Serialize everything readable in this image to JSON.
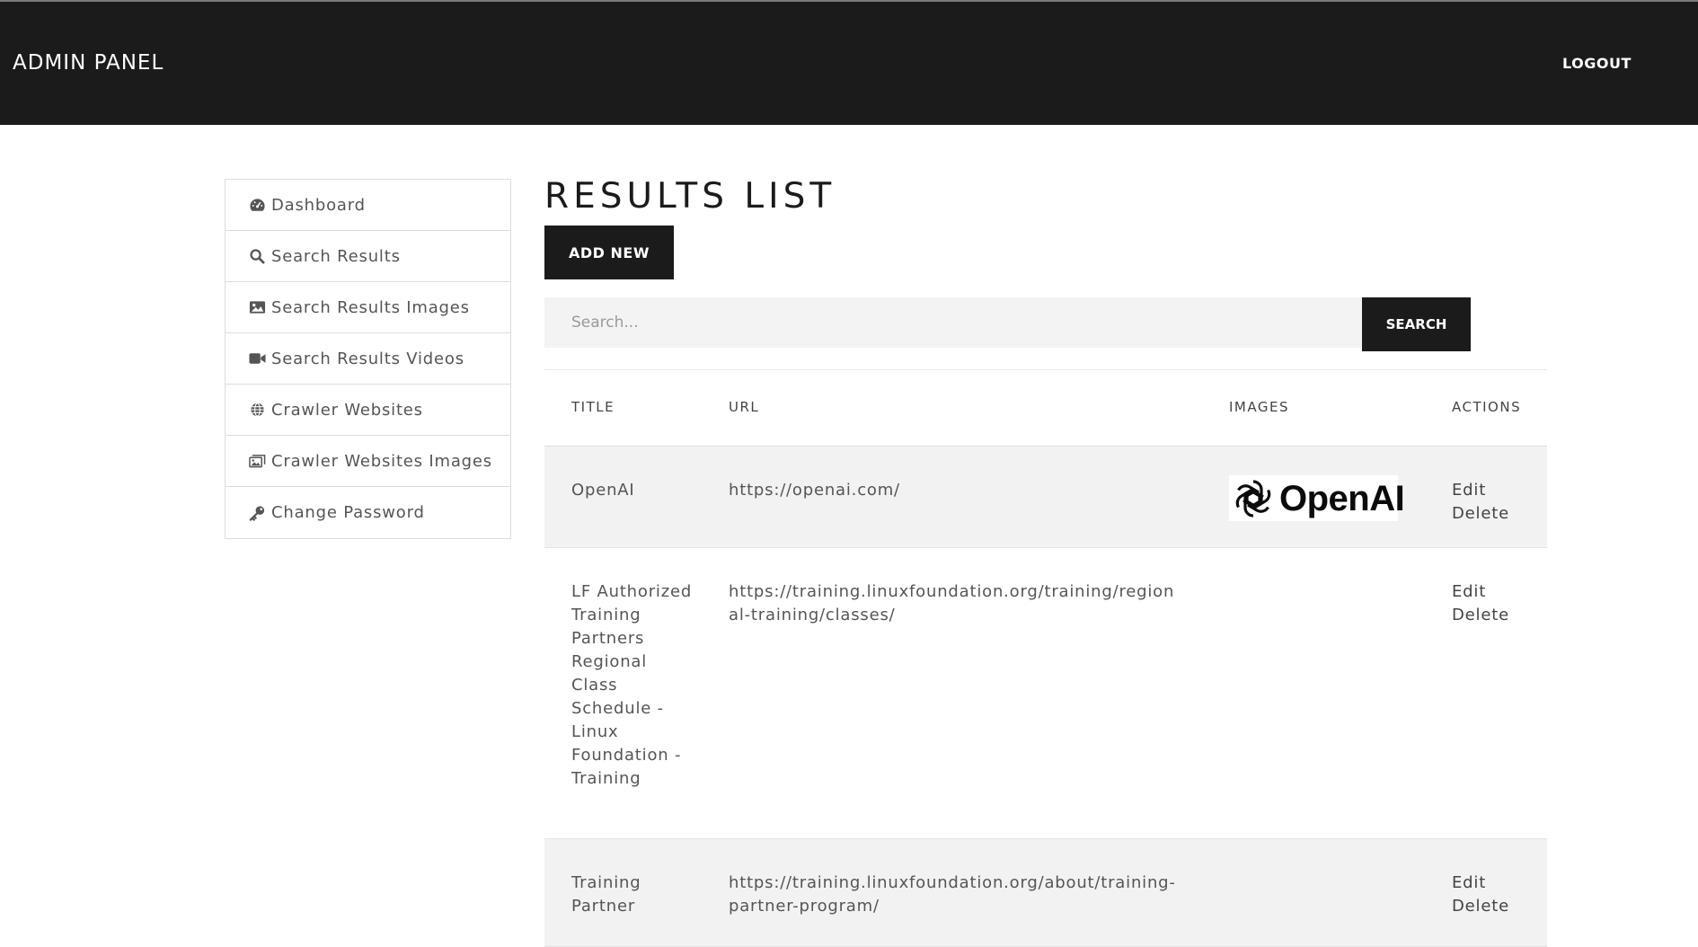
{
  "header": {
    "brand": "ADMIN PANEL",
    "logout_label": "LOGOUT"
  },
  "sidebar": {
    "items": [
      {
        "label": "Dashboard",
        "icon": "gauge-icon"
      },
      {
        "label": "Search Results",
        "icon": "search-icon"
      },
      {
        "label": "Search Results Images",
        "icon": "image-icon"
      },
      {
        "label": "Search Results Videos",
        "icon": "video-icon"
      },
      {
        "label": "Crawler Websites",
        "icon": "globe-icon"
      },
      {
        "label": "Crawler Websites Images",
        "icon": "images-icon"
      },
      {
        "label": "Change Password",
        "icon": "key-icon"
      }
    ]
  },
  "main": {
    "title": "RESULTS LIST",
    "add_new_label": "ADD NEW",
    "search": {
      "placeholder": "Search...",
      "value": "",
      "button_label": "SEARCH"
    },
    "table": {
      "columns": [
        "TITLE",
        "URL",
        "IMAGES",
        "ACTIONS"
      ],
      "rows": [
        {
          "title": "OpenAI",
          "url": "https://openai.com/",
          "image_logo_text": "OpenAI",
          "edit_label": "Edit",
          "delete_label": "Delete"
        },
        {
          "title": "LF Authorized Training Partners Regional Class Schedule - Linux Foundation - Training",
          "url": "https://training.linuxfoundation.org/training/regional-training/classes/",
          "edit_label": "Edit",
          "delete_label": "Delete"
        },
        {
          "title": "Training Partner",
          "url": "https://training.linuxfoundation.org/about/training-partner-program/",
          "edit_label": "Edit",
          "delete_label": "Delete"
        }
      ]
    }
  },
  "colors": {
    "navbar_bg": "#1b1b1b",
    "button_bg": "#1b1b1b",
    "row_shade": "#f2f2f2",
    "search_bg": "#f3f3f3"
  }
}
